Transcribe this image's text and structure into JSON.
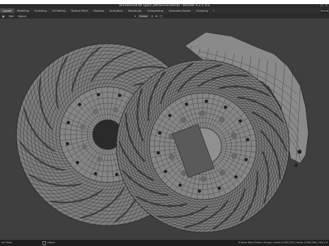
{
  "window": {
    "title": "BrembProdFRK Sport_withScene.blend] - Blender 4.2.1 LTS"
  },
  "workspaces": {
    "items": [
      "Layout",
      "Modeling",
      "Sculpting",
      "UV Editing",
      "Texture Paint",
      "Shading",
      "Animation",
      "Rendering",
      "Compositing",
      "Geometry Nodes",
      "Scripting"
    ],
    "add_label": "+"
  },
  "scene_field": {
    "label": "Scene"
  },
  "header3d": {
    "menu_items": [
      "Edit",
      "Object"
    ],
    "orientation_label": "Global"
  },
  "statusbar": {
    "left_text": "ect View",
    "mid_text": "Object",
    "right_text": "R Sport Rear Brake | Empty | Verts 6,338,374 | Faces 5,938,186 | Tris 5,9"
  },
  "colors": {
    "viewport_bg": "#3f3f3f",
    "mesh_fill": "#7b7b7b",
    "wire": "#2c2c2c",
    "bolt": "#222222"
  }
}
